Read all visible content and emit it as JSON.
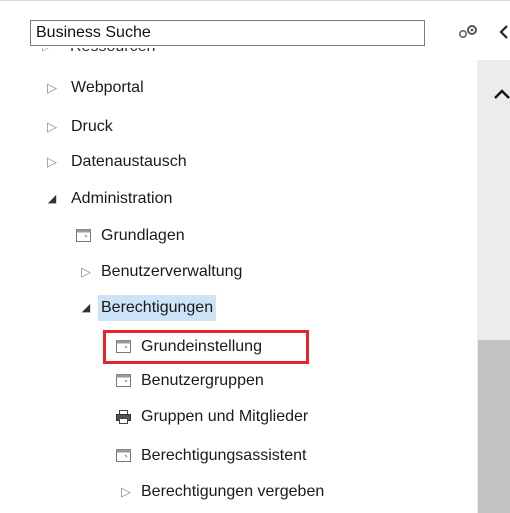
{
  "search": {
    "value": "Business Suche"
  },
  "tree": {
    "cut_item": "Ressourcen",
    "items": [
      {
        "label": "Webportal",
        "state": "collapsed"
      },
      {
        "label": "Druck",
        "state": "collapsed"
      },
      {
        "label": "Datenaustausch",
        "state": "collapsed"
      },
      {
        "label": "Administration",
        "state": "expanded"
      },
      {
        "label": "Grundlagen",
        "state": "page"
      },
      {
        "label": "Benutzerverwaltung",
        "state": "collapsed"
      },
      {
        "label": "Berechtigungen",
        "state": "expanded"
      },
      {
        "label": "Grundeinstellung",
        "state": "page"
      },
      {
        "label": "Benutzergruppen",
        "state": "page"
      },
      {
        "label": "Gruppen und Mitglieder",
        "state": "page"
      },
      {
        "label": "Berechtigungsassistent",
        "state": "page"
      },
      {
        "label": "Berechtigungen vergeben",
        "state": "collapsed"
      }
    ]
  },
  "colors": {
    "highlight": "#e8232a",
    "selection": "#cde3f8"
  }
}
